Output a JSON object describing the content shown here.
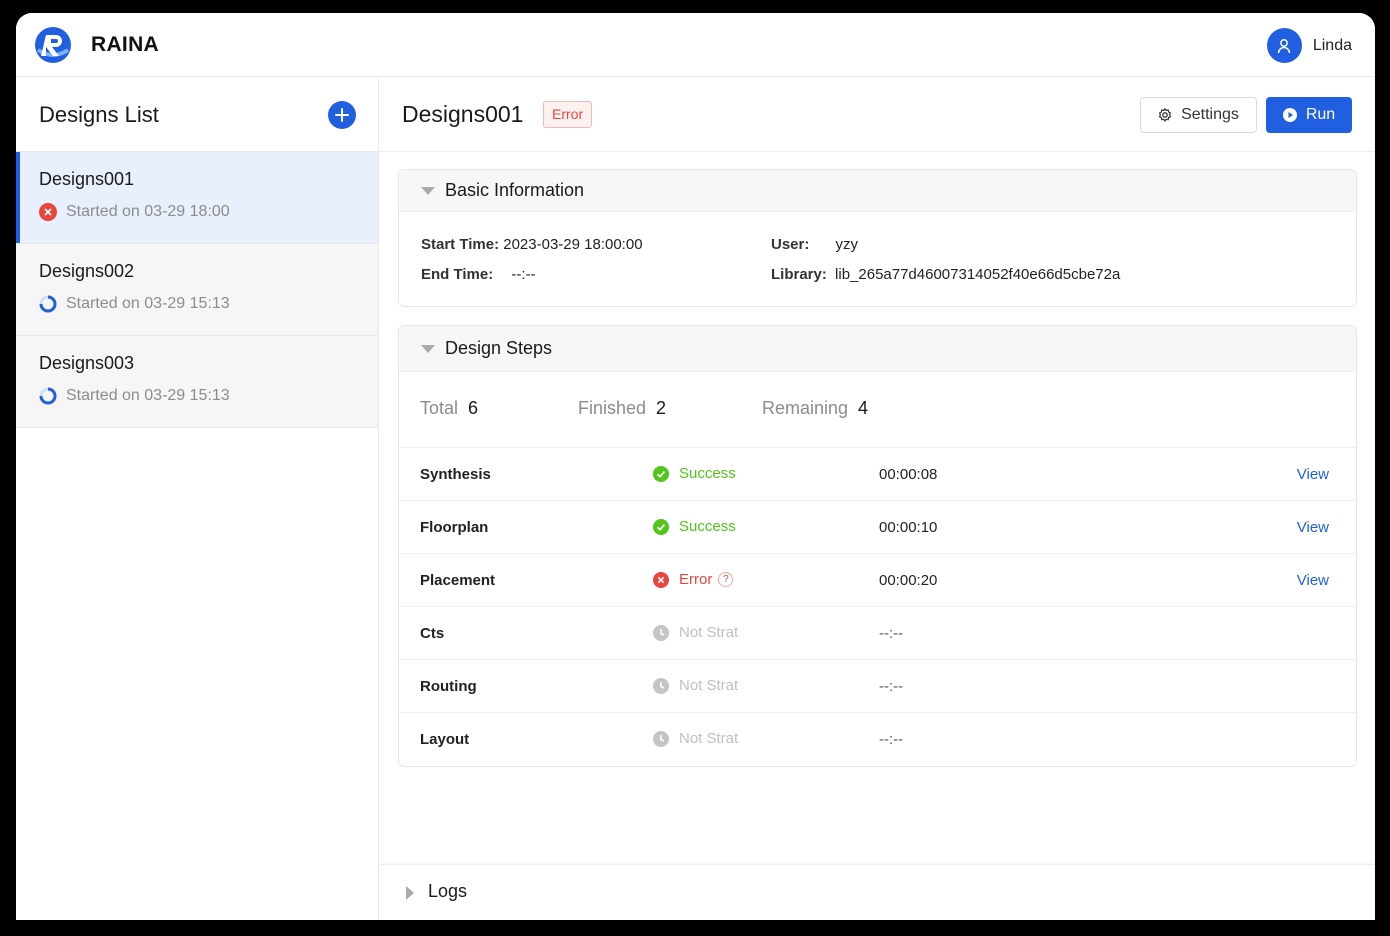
{
  "app": {
    "brand": "RAINA",
    "user_name": "Linda"
  },
  "colors": {
    "accent": "#1f5fe0",
    "success": "#52c41a",
    "error": "#e8453c",
    "muted": "#bfbfbf"
  },
  "sidebar": {
    "title": "Designs List",
    "items": [
      {
        "name": "Designs001",
        "meta": "Started on 03-29 18:00",
        "status_icon": "error-icon"
      },
      {
        "name": "Designs002",
        "meta": "Started on 03-29 15:13",
        "status_icon": "loading-icon"
      },
      {
        "name": "Designs003",
        "meta": "Started on 03-29 15:13",
        "status_icon": "loading-icon"
      }
    ]
  },
  "main": {
    "title": "Designs001",
    "status_tag": "Error",
    "settings_label": "Settings",
    "run_label": "Run",
    "basic": {
      "title": "Basic Information",
      "start_time_label": "Start Time:",
      "start_time": "2023-03-29 18:00:00",
      "end_time_label": "End Time:",
      "end_time": "--:--",
      "user_label": "User:",
      "user": "yzy",
      "library_label": "Library:",
      "library": "lib_265a77d46007314052f40e66d5cbe72a"
    },
    "steps": {
      "title": "Design Steps",
      "total_label": "Total",
      "total": "6",
      "finished_label": "Finished",
      "finished": "2",
      "remaining_label": "Remaining",
      "remaining": "4",
      "rows": [
        {
          "name": "Synthesis",
          "status": "Success",
          "time": "00:00:08",
          "action": "View"
        },
        {
          "name": "Floorplan",
          "status": "Success",
          "time": "00:00:10",
          "action": "View"
        },
        {
          "name": "Placement",
          "status": "Error",
          "time": "00:00:20",
          "action": "View"
        },
        {
          "name": "Cts",
          "status": "Not Strat",
          "time": "--:--",
          "action": ""
        },
        {
          "name": "Routing",
          "status": "Not Strat",
          "time": "--:--",
          "action": ""
        },
        {
          "name": "Layout",
          "status": "Not Strat",
          "time": "--:--",
          "action": ""
        }
      ]
    },
    "logs_title": "Logs"
  }
}
